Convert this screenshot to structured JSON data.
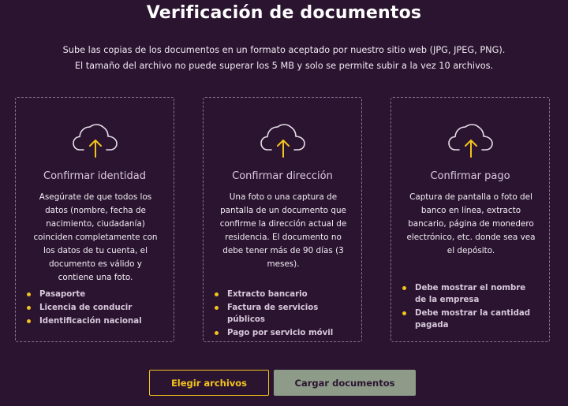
{
  "page": {
    "title": "Verificación de documentos",
    "subtitle_line1": "Sube las copias de los documentos en un formato aceptado por nuestro sitio web (JPG, JPEG, PNG).",
    "subtitle_line2": "El tamaño del archivo no puede superar los 5 MB y solo se permite subir a la vez 10 archivos."
  },
  "cards": [
    {
      "icon": "cloud-upload-icon",
      "title": "Confirmar identidad",
      "description": "Asegúrate de que todos los datos (nombre, fecha de nacimiento, ciudadanía) coinciden completamente con los datos de tu cuenta, el documento es válido y contiene una foto.",
      "items": [
        "Pasaporte",
        "Licencia de conducir",
        "Identificación nacional"
      ]
    },
    {
      "icon": "cloud-upload-icon",
      "title": "Confirmar dirección",
      "description": "Una foto o una captura de pantalla de un documento que confirme la dirección actual de residencia. El documento no debe tener más de 90 días (3 meses).",
      "items": [
        "Extracto bancario",
        "Factura de servicios públicos",
        "Pago por servicio móvil"
      ]
    },
    {
      "icon": "cloud-upload-icon",
      "title": "Confirmar pago",
      "description": "Captura de pantalla o foto del banco en línea, extracto bancario, página de monedero electrónico, etc. donde sea vea el depósito.",
      "items": [
        "Debe mostrar el nombre de la empresa",
        "Debe mostrar la cantidad pagada"
      ]
    }
  ],
  "buttons": {
    "choose_files": "Elegir archivos",
    "upload_documents": "Cargar documentos"
  },
  "colors": {
    "background": "#2b1430",
    "accent": "#f3c31d",
    "upload_button": "#8e9b89"
  }
}
